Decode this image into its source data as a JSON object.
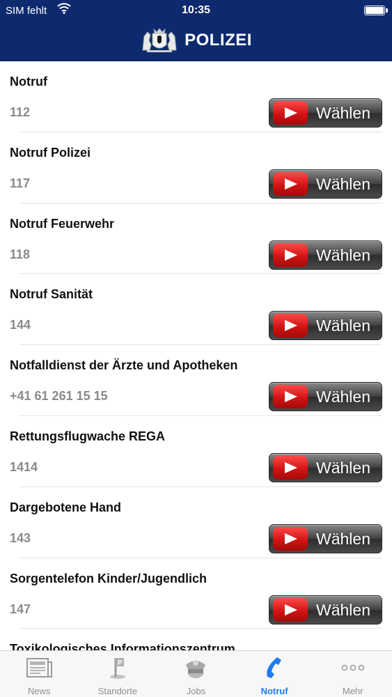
{
  "status_bar": {
    "carrier": "SIM fehlt",
    "time": "10:35"
  },
  "header": {
    "title": "POLIZEI"
  },
  "call_button_label": "Wählen",
  "contacts": [
    {
      "name": "Notruf",
      "number": "112"
    },
    {
      "name": "Notruf Polizei",
      "number": "117"
    },
    {
      "name": "Notruf Feuerwehr",
      "number": "118"
    },
    {
      "name": "Notruf Sanität",
      "number": "144"
    },
    {
      "name": "Notfalldienst der Ärzte und Apotheken",
      "number": "+41 61 261 15 15"
    },
    {
      "name": "Rettungsflugwache REGA",
      "number": "1414"
    },
    {
      "name": "Dargebotene Hand",
      "number": "143"
    },
    {
      "name": "Sorgentelefon Kinder/Jugendlich",
      "number": "147"
    },
    {
      "name": "Toxikologisches Informationszentrum",
      "number": ""
    }
  ],
  "tabs": [
    {
      "label": "News",
      "icon": "newspaper-icon"
    },
    {
      "label": "Standorte",
      "icon": "map-pin-icon"
    },
    {
      "label": "Jobs",
      "icon": "police-cap-icon"
    },
    {
      "label": "Notruf",
      "icon": "phone-icon",
      "active": true
    },
    {
      "label": "Mehr",
      "icon": "more-dots-icon"
    }
  ],
  "colors": {
    "header_bg": "#0e2a6e",
    "active_tab": "#1d7cf2",
    "play_red": "#e02020"
  }
}
